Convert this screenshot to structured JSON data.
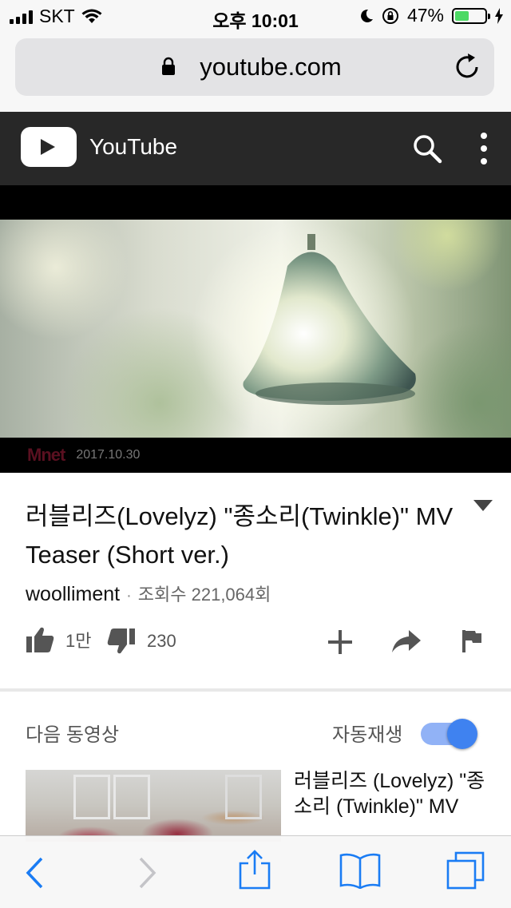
{
  "status_bar": {
    "carrier": "SKT",
    "time": "오후 10:01",
    "battery_percent": "47%",
    "battery_level": 0.47
  },
  "browser": {
    "url": "youtube.com"
  },
  "youtube": {
    "brand": "YouTube"
  },
  "player": {
    "watermark_date": "2017.10.30",
    "watermark_logo": "Mnet"
  },
  "video": {
    "title": "러블리즈(Lovelyz) \"종소리(Twinkle)\" MV Teaser (Short ver.)",
    "channel": "woolliment",
    "separator": "·",
    "views": "조회수 221,064회",
    "likes": "1만",
    "dislikes": "230"
  },
  "up_next": {
    "label": "다음 동영상",
    "autoplay_label": "자동재생",
    "autoplay_on": true,
    "items": [
      {
        "title": "러블리즈 (Lovelyz) \"종소리 (Twinkle)\" MV"
      }
    ]
  },
  "colors": {
    "header_bg": "#282828",
    "toggle_on": "#3f82f0",
    "safari_blue": "#1a7cf4"
  }
}
